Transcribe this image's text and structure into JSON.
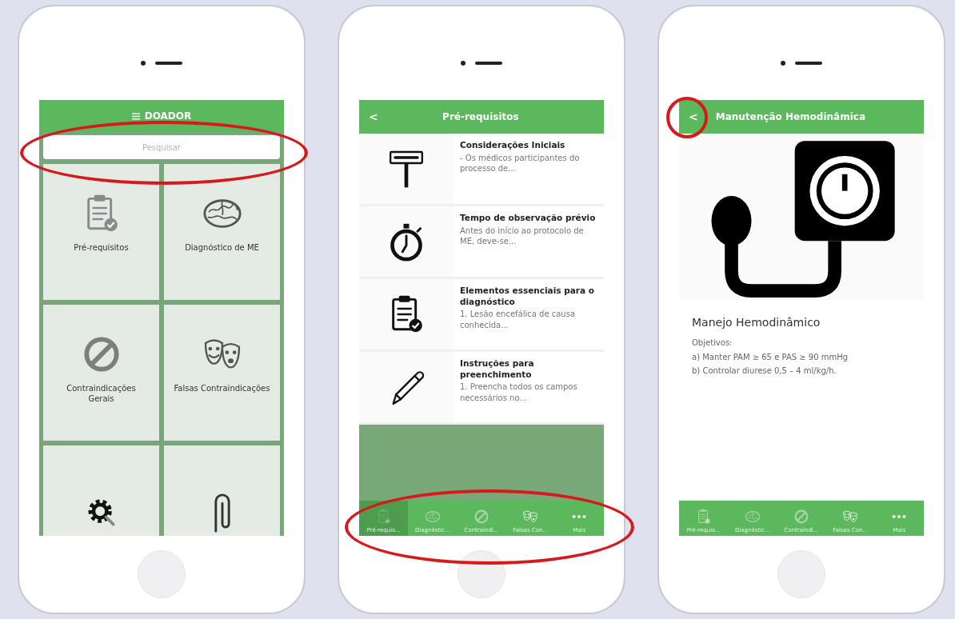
{
  "phones": [
    {
      "kind": "home",
      "header": {
        "title": "DOADOR"
      },
      "search": {
        "placeholder": "Pesquisar",
        "circled": true
      },
      "tiles": [
        {
          "kind": "clipboard",
          "label": "Pré-requisitos"
        },
        {
          "kind": "brain",
          "label": "Diagnóstico de ME"
        },
        {
          "kind": "prohibited",
          "label": "Contraindicações Gerais"
        },
        {
          "kind": "masks",
          "label": "Falsas Contraindicações"
        },
        {
          "kind": "gear"
        },
        {
          "kind": "clip"
        }
      ]
    },
    {
      "kind": "list",
      "header": {
        "title": "Pré-requisitos",
        "back": "<",
        "back_circled": false
      },
      "items": [
        {
          "kind": "sign",
          "title": "Considerações Iniciais",
          "excerpt": "- Os médicos participantes do processo de..."
        },
        {
          "kind": "stopwatch",
          "title": "Tempo de observação prévio",
          "excerpt": "Antes do início ao protocolo de ME, deve-se..."
        },
        {
          "kind": "clipboard",
          "title": "Elementos essenciais para o diagnóstico",
          "excerpt": "1. Lesão encefálica de causa conhecida..."
        },
        {
          "kind": "pencil",
          "title": "Instruções para preenchimento",
          "excerpt": "1. Preencha todos os campos necessários no..."
        }
      ],
      "tabbar": {
        "circled": true,
        "tabs": [
          {
            "kind": "clipboard",
            "label": "Pré-requis...",
            "selected": true
          },
          {
            "kind": "brain",
            "label": "Diagnóstic...",
            "selected": false
          },
          {
            "kind": "prohibited",
            "label": "Contraindi...",
            "selected": false
          },
          {
            "kind": "masks",
            "label": "Falsas Con...",
            "selected": false
          },
          {
            "kind": "dots",
            "label": "Mais",
            "selected": false
          }
        ]
      }
    },
    {
      "kind": "detail",
      "header": {
        "title": "Manutenção Hemodinâmica",
        "back": "<",
        "back_circled": true
      },
      "content": {
        "title": "Manejo Hemodinâmico",
        "lines": [
          "Objetivos:",
          "a) Manter PAM ≥ 65 e PAS ≥ 90 mmHg",
          "b) Controlar diurese 0,5 – 4 ml/kg/h."
        ]
      },
      "tabbar": {
        "circled": false,
        "tabs": [
          {
            "kind": "clipboard",
            "label": "Pré-requis...",
            "selected": false
          },
          {
            "kind": "brain",
            "label": "Diagnóstic...",
            "selected": false
          },
          {
            "kind": "prohibited",
            "label": "Contraindi...",
            "selected": false
          },
          {
            "kind": "masks",
            "label": "Falsas Con...",
            "selected": false
          },
          {
            "kind": "dots",
            "label": "Mais",
            "selected": false
          }
        ]
      }
    }
  ]
}
